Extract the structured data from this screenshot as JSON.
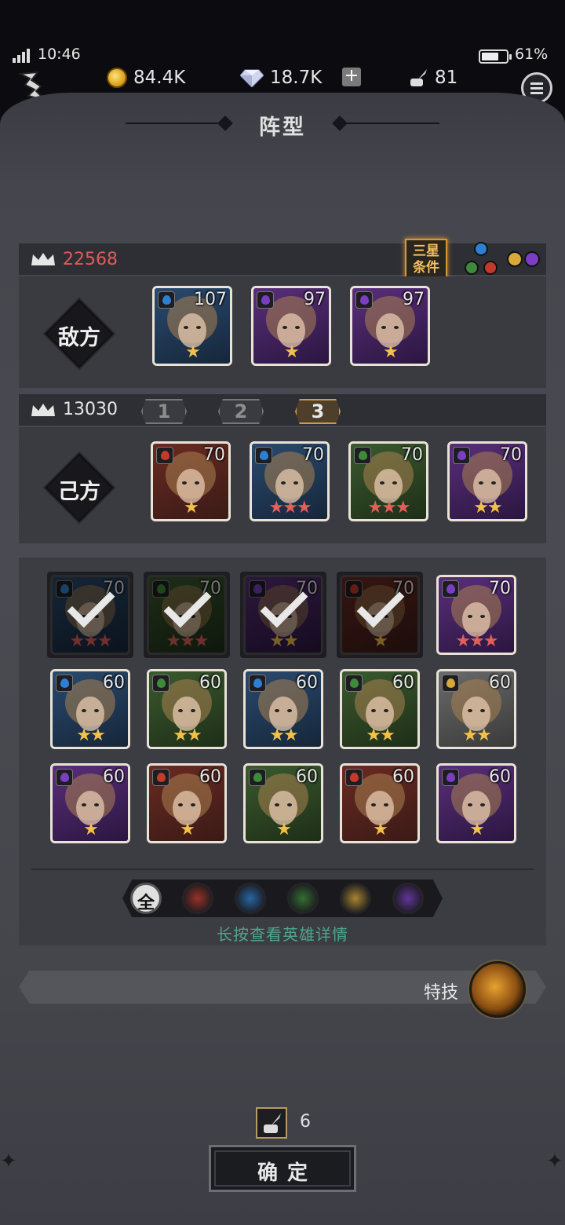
{
  "status": {
    "time": "10:46",
    "battery": "61%",
    "battery_level": 0.61
  },
  "resources": {
    "gold": "84.4K",
    "gems": "18.7K",
    "plus": "+",
    "ink": "81"
  },
  "title": "阵型",
  "enemy": {
    "power": "22568",
    "label": "敌方",
    "three_star_badge": "三星\n条件",
    "heroes": [
      {
        "level": "107",
        "element": "water",
        "stars": 1
      },
      {
        "level": "97",
        "element": "dark",
        "stars": 1
      },
      {
        "level": "97",
        "element": "dark",
        "stars": 1
      }
    ]
  },
  "ally": {
    "power": "13030",
    "label": "己方",
    "slots": [
      "1",
      "2",
      "3"
    ],
    "active_slot": "3",
    "heroes": [
      {
        "level": "70",
        "element": "fire",
        "stars": 1
      },
      {
        "level": "70",
        "element": "water",
        "stars": 3
      },
      {
        "level": "70",
        "element": "nature",
        "stars": 3
      },
      {
        "level": "70",
        "element": "dark",
        "stars": 2
      }
    ]
  },
  "roster": [
    {
      "level": "70",
      "element": "water",
      "stars": 3,
      "selected": true
    },
    {
      "level": "70",
      "element": "nature",
      "stars": 3,
      "selected": true
    },
    {
      "level": "70",
      "element": "dark",
      "stars": 2,
      "selected": true
    },
    {
      "level": "70",
      "element": "fire",
      "stars": 1,
      "selected": true
    },
    {
      "level": "70",
      "element": "dark",
      "stars": 3,
      "selected": false
    },
    {
      "level": "60",
      "element": "water",
      "stars": 2,
      "selected": false
    },
    {
      "level": "60",
      "element": "nature",
      "stars": 2,
      "selected": false
    },
    {
      "level": "60",
      "element": "water",
      "stars": 2,
      "selected": false
    },
    {
      "level": "60",
      "element": "nature",
      "stars": 2,
      "selected": false
    },
    {
      "level": "60",
      "element": "light",
      "stars": 2,
      "selected": false
    },
    {
      "level": "60",
      "element": "dark",
      "stars": 1,
      "selected": false
    },
    {
      "level": "60",
      "element": "fire",
      "stars": 1,
      "selected": false
    },
    {
      "level": "60",
      "element": "nature",
      "stars": 1,
      "selected": false
    },
    {
      "level": "60",
      "element": "fire",
      "stars": 1,
      "selected": false
    },
    {
      "level": "60",
      "element": "dark",
      "stars": 1,
      "selected": false
    }
  ],
  "filters": {
    "all": "全",
    "elements": [
      "fire",
      "water",
      "nature",
      "light",
      "dark"
    ]
  },
  "hint": "长按查看英雄详情",
  "skill_label": "特技",
  "cost": "6",
  "confirm": "确定",
  "colors": {
    "fire": "#c23a2a",
    "water": "#2f7fd0",
    "nature": "#3f8a3a",
    "light": "#d8a83a",
    "dark": "#7a3fc0",
    "star_gold": "#f2c14a",
    "star_red": "#e0605a",
    "enemy_power": "#e05a5a"
  }
}
